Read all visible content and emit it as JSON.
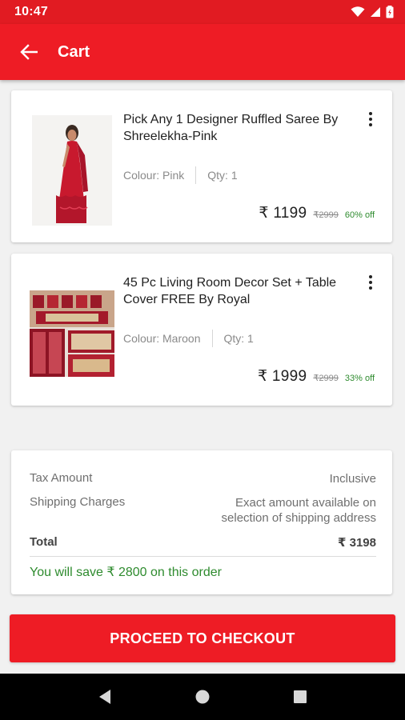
{
  "status_bar": {
    "time": "10:47"
  },
  "app_bar": {
    "title": "Cart"
  },
  "items": [
    {
      "name": "Pick Any 1 Designer Ruffled Saree By Shreelekha-Pink",
      "colour": "Colour: Pink",
      "qty": "Qty: 1",
      "price": "₹ 1199",
      "mrp": "₹2999",
      "discount": "60% off"
    },
    {
      "name": "45 Pc Living Room Decor Set + Table Cover FREE By Royal",
      "colour": "Colour: Maroon",
      "qty": "Qty: 1",
      "price": "₹ 1999",
      "mrp": "₹2999",
      "discount": "33% off"
    }
  ],
  "summary": {
    "tax_label": "Tax Amount",
    "tax_value": "Inclusive",
    "shipping_label": "Shipping Charges",
    "shipping_value_line1": "Exact amount available on",
    "shipping_value_line2": "selection of shipping address",
    "total_label": "Total",
    "total_value": "₹ 3198",
    "savings": "You will save ₹ 2800 on this order"
  },
  "checkout_label": "PROCEED TO CHECKOUT",
  "colors": {
    "primary": "#ee1c25",
    "status_bar": "#e11b22",
    "success": "#2e8b2e"
  }
}
